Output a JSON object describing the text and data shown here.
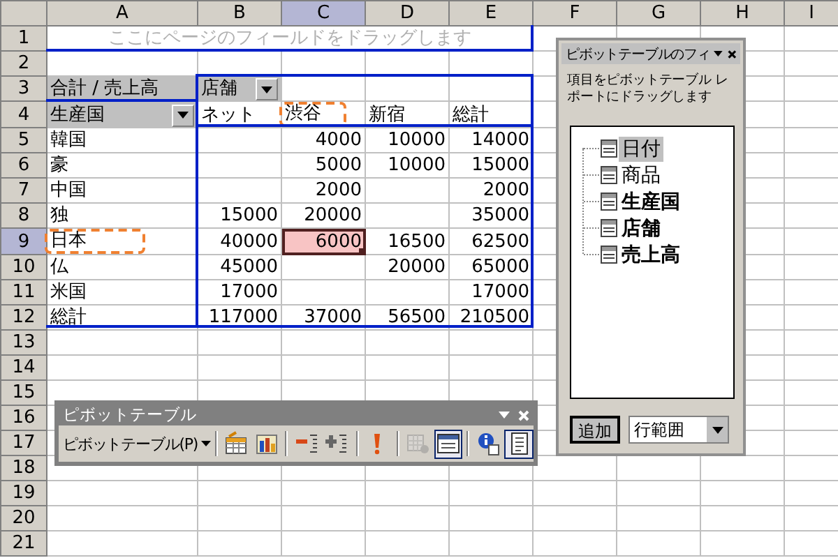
{
  "sheet": {
    "column_headers": [
      {
        "label": "A",
        "selected": false
      },
      {
        "label": "B",
        "selected": false
      },
      {
        "label": "C",
        "selected": true
      },
      {
        "label": "D",
        "selected": false
      },
      {
        "label": "E",
        "selected": false
      },
      {
        "label": "F",
        "selected": false
      },
      {
        "label": "G",
        "selected": false
      },
      {
        "label": "H",
        "selected": false
      },
      {
        "label": "I",
        "selected": false
      }
    ],
    "row_headers": [
      {
        "label": "1",
        "selected": false
      },
      {
        "label": "2",
        "selected": false
      },
      {
        "label": "3",
        "selected": false
      },
      {
        "label": "4",
        "selected": false
      },
      {
        "label": "5",
        "selected": false
      },
      {
        "label": "6",
        "selected": false
      },
      {
        "label": "7",
        "selected": false
      },
      {
        "label": "8",
        "selected": false
      },
      {
        "label": "9",
        "selected": true
      },
      {
        "label": "10",
        "selected": false
      },
      {
        "label": "11",
        "selected": false
      },
      {
        "label": "12",
        "selected": false
      },
      {
        "label": "13",
        "selected": false
      },
      {
        "label": "14",
        "selected": false
      },
      {
        "label": "15",
        "selected": false
      },
      {
        "label": "16",
        "selected": false
      },
      {
        "label": "17",
        "selected": false
      },
      {
        "label": "18",
        "selected": false
      },
      {
        "label": "19",
        "selected": false
      },
      {
        "label": "20",
        "selected": false
      },
      {
        "label": "21",
        "selected": false
      }
    ]
  },
  "pivot": {
    "page_hint": "ここにページのフィールドをドラッグします",
    "data_field": "合計 / 売上高",
    "column_field": "店舗",
    "row_field": "生産国",
    "column_items": [
      {
        "label": "ネット",
        "highlighted": false
      },
      {
        "label": "渋谷",
        "highlighted": true
      },
      {
        "label": "新宿",
        "highlighted": false
      },
      {
        "label": "総計",
        "highlighted": false
      }
    ],
    "rows": [
      {
        "label": "韓国",
        "highlighted": false,
        "cells": [
          null,
          {
            "text": "4000",
            "selected": false
          },
          {
            "text": "10000",
            "selected": false
          },
          {
            "text": "14000",
            "selected": false
          }
        ]
      },
      {
        "label": "豪",
        "highlighted": false,
        "cells": [
          null,
          {
            "text": "5000",
            "selected": false
          },
          {
            "text": "10000",
            "selected": false
          },
          {
            "text": "15000",
            "selected": false
          }
        ]
      },
      {
        "label": "中国",
        "highlighted": false,
        "cells": [
          null,
          {
            "text": "2000",
            "selected": false
          },
          null,
          {
            "text": "2000",
            "selected": false
          }
        ]
      },
      {
        "label": "独",
        "highlighted": false,
        "cells": [
          {
            "text": "15000",
            "selected": false
          },
          {
            "text": "20000",
            "selected": false
          },
          null,
          {
            "text": "35000",
            "selected": false
          }
        ]
      },
      {
        "label": "日本",
        "highlighted": true,
        "cells": [
          {
            "text": "40000",
            "selected": false
          },
          {
            "text": "6000",
            "selected": true
          },
          {
            "text": "16500",
            "selected": false
          },
          {
            "text": "62500",
            "selected": false
          }
        ]
      },
      {
        "label": "仏",
        "highlighted": false,
        "cells": [
          {
            "text": "45000",
            "selected": false
          },
          null,
          {
            "text": "20000",
            "selected": false
          },
          {
            "text": "65000",
            "selected": false
          }
        ]
      },
      {
        "label": "米国",
        "highlighted": false,
        "cells": [
          {
            "text": "17000",
            "selected": false
          },
          null,
          null,
          {
            "text": "17000",
            "selected": false
          }
        ]
      },
      {
        "label": "総計",
        "highlighted": false,
        "cells": [
          {
            "text": "117000",
            "selected": false
          },
          {
            "text": "37000",
            "selected": false
          },
          {
            "text": "56500",
            "selected": false
          },
          {
            "text": "210500",
            "selected": false
          }
        ]
      }
    ]
  },
  "field_list": {
    "title": "ピボットテーブルのフィ",
    "hint": "項目をピボットテーブル レポートにドラッグします",
    "fields": [
      {
        "label": "日付",
        "used": false,
        "selected": true
      },
      {
        "label": "商品",
        "used": false,
        "selected": false
      },
      {
        "label": "生産国",
        "used": true,
        "selected": false
      },
      {
        "label": "店舗",
        "used": true,
        "selected": false
      },
      {
        "label": "売上高",
        "used": true,
        "selected": false
      }
    ],
    "add_button": "追加",
    "area": "行範囲"
  },
  "toolbar": {
    "title": "ピボットテーブル",
    "menu": "ピボットテーブル(P)",
    "tools": [
      {
        "kind": "separator"
      },
      {
        "kind": "format",
        "pressed": false,
        "disabled": false
      },
      {
        "kind": "chart",
        "pressed": false,
        "disabled": false
      },
      {
        "kind": "separator"
      },
      {
        "kind": "hide",
        "pressed": false,
        "disabled": false
      },
      {
        "kind": "show",
        "pressed": false,
        "disabled": false
      },
      {
        "kind": "separator"
      },
      {
        "kind": "refresh",
        "pressed": false,
        "disabled": false
      },
      {
        "kind": "separator"
      },
      {
        "kind": "settings",
        "pressed": false,
        "disabled": true
      },
      {
        "kind": "fieldlist",
        "pressed": true,
        "disabled": false
      },
      {
        "kind": "separator"
      },
      {
        "kind": "info",
        "pressed": false,
        "disabled": false
      },
      {
        "kind": "display",
        "pressed": true,
        "disabled": false
      }
    ]
  }
}
